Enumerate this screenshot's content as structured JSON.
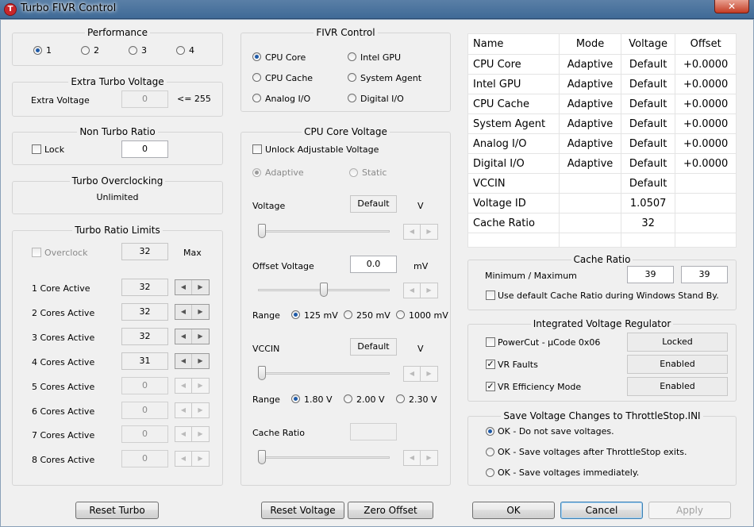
{
  "window": {
    "title": "Turbo FIVR Control",
    "close_glyph": "✕"
  },
  "performance": {
    "title": "Performance",
    "options": [
      "1",
      "2",
      "3",
      "4"
    ],
    "selected": "1"
  },
  "extra_turbo": {
    "title": "Extra Turbo Voltage",
    "label": "Extra Voltage",
    "value": "0",
    "suffix": "<= 255"
  },
  "non_turbo": {
    "title": "Non Turbo Ratio",
    "lock_label": "Lock",
    "value": "0"
  },
  "turbo_oc": {
    "title": "Turbo Overclocking",
    "status": "Unlimited"
  },
  "turbo_limits": {
    "title": "Turbo Ratio Limits",
    "overclock_label": "Overclock",
    "overclock_value": "32",
    "max_label": "Max",
    "rows": [
      {
        "label": "1 Core Active",
        "value": "32"
      },
      {
        "label": "2 Cores Active",
        "value": "32"
      },
      {
        "label": "3 Cores Active",
        "value": "32"
      },
      {
        "label": "4 Cores Active",
        "value": "31"
      },
      {
        "label": "5 Cores Active",
        "value": "0"
      },
      {
        "label": "6 Cores Active",
        "value": "0"
      },
      {
        "label": "7 Cores Active",
        "value": "0"
      },
      {
        "label": "8 Cores Active",
        "value": "0"
      }
    ]
  },
  "fivr": {
    "title": "FIVR Control",
    "options": [
      "CPU Core",
      "CPU Cache",
      "Analog I/O",
      "Intel GPU",
      "System Agent",
      "Digital I/O"
    ],
    "selected": "CPU Core"
  },
  "core_voltage": {
    "title": "CPU Core Voltage",
    "unlock_label": "Unlock Adjustable Voltage",
    "adaptive_label": "Adaptive",
    "static_label": "Static",
    "voltage_label": "Voltage",
    "voltage_value": "Default",
    "voltage_unit": "V",
    "offset_label": "Offset Voltage",
    "offset_value": "0.0",
    "offset_unit": "mV",
    "range_label": "Range",
    "offset_ranges": [
      "125 mV",
      "250 mV",
      "1000 mV"
    ],
    "offset_range_selected": "125 mV",
    "vccin_label": "VCCIN",
    "vccin_value": "Default",
    "vccin_unit": "V",
    "vccin_ranges": [
      "1.80 V",
      "2.00 V",
      "2.30 V"
    ],
    "vccin_range_selected": "1.80 V",
    "cache_ratio_label": "Cache Ratio",
    "cache_ratio_value": "",
    "offset_slider_level": 0.5
  },
  "table": {
    "headers": [
      "Name",
      "Mode",
      "Voltage",
      "Offset"
    ],
    "rows": [
      [
        "CPU Core",
        "Adaptive",
        "Default",
        "+0.0000"
      ],
      [
        "Intel GPU",
        "Adaptive",
        "Default",
        "+0.0000"
      ],
      [
        "CPU Cache",
        "Adaptive",
        "Default",
        "+0.0000"
      ],
      [
        "System Agent",
        "Adaptive",
        "Default",
        "+0.0000"
      ],
      [
        "Analog I/O",
        "Adaptive",
        "Default",
        "+0.0000"
      ],
      [
        "Digital I/O",
        "Adaptive",
        "Default",
        "+0.0000"
      ],
      [
        "VCCIN",
        "",
        "Default",
        ""
      ],
      [
        "Voltage ID",
        "",
        "1.0507",
        ""
      ],
      [
        "Cache Ratio",
        "",
        "32",
        ""
      ]
    ]
  },
  "cache_ratio": {
    "title": "Cache Ratio",
    "label": "Minimum / Maximum",
    "min": "39",
    "max": "39",
    "default_label": "Use default Cache Ratio during Windows Stand By."
  },
  "ivr": {
    "title": "Integrated Voltage Regulator",
    "items": [
      {
        "label": "PowerCut  -  µCode 0x06",
        "checked": false,
        "status": "Locked"
      },
      {
        "label": "VR Faults",
        "checked": true,
        "status": "Enabled"
      },
      {
        "label": "VR Efficiency Mode",
        "checked": true,
        "status": "Enabled"
      }
    ]
  },
  "save": {
    "title": "Save Voltage Changes to ThrottleStop.INI",
    "options": [
      "OK - Do not save voltages.",
      "OK - Save voltages after ThrottleStop exits.",
      "OK - Save voltages immediately."
    ],
    "selected": "OK - Do not save voltages."
  },
  "buttons": {
    "reset_turbo": "Reset Turbo",
    "reset_voltage": "Reset Voltage",
    "zero_offset": "Zero Offset",
    "ok": "OK",
    "cancel": "Cancel",
    "apply": "Apply"
  },
  "check_mark": "✓",
  "spin_left": "◀",
  "spin_right": "▶"
}
